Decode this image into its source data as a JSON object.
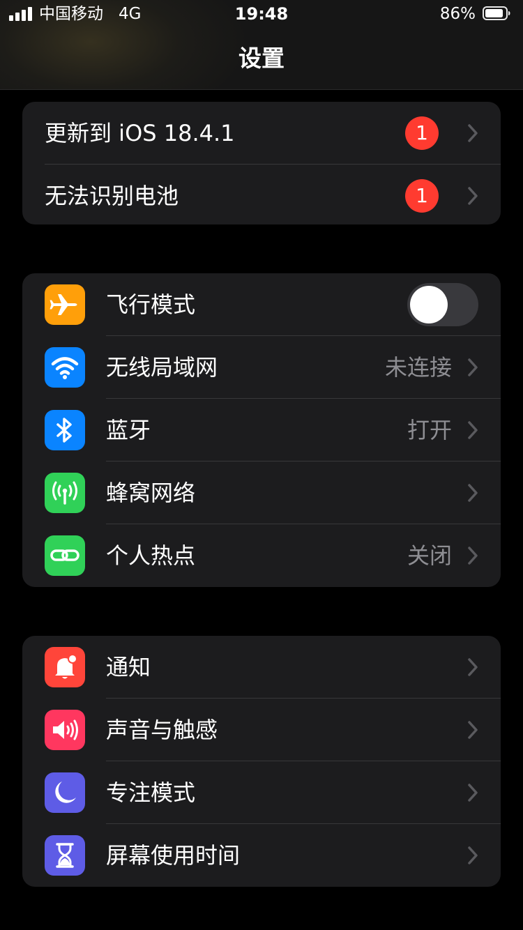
{
  "status_bar": {
    "carrier": "中国移动",
    "network": "4G",
    "time": "19:48",
    "battery_percent": "86%",
    "signal_bars_filled": 4
  },
  "nav": {
    "title": "设置"
  },
  "alerts": [
    {
      "label": "更新到 iOS 18.4.1",
      "badge": "1"
    },
    {
      "label": "无法识别电池",
      "badge": "1"
    }
  ],
  "connectivity": [
    {
      "label": "飞行模式",
      "icon": "airplane-icon",
      "icon_color": "#ff9f0a",
      "toggle_on": false
    },
    {
      "label": "无线局域网",
      "icon": "wifi-icon",
      "icon_color": "#0a84ff",
      "value": "未连接"
    },
    {
      "label": "蓝牙",
      "icon": "bluetooth-icon",
      "icon_color": "#0a84ff",
      "value": "打开"
    },
    {
      "label": "蜂窝网络",
      "icon": "cellular-icon",
      "icon_color": "#30d158"
    },
    {
      "label": "个人热点",
      "icon": "hotspot-icon",
      "icon_color": "#30d158",
      "value": "关闭"
    }
  ],
  "system": [
    {
      "label": "通知",
      "icon": "notification-bell-icon",
      "icon_color": "#ff453a"
    },
    {
      "label": "声音与触感",
      "icon": "speaker-icon",
      "icon_color": "#ff375f"
    },
    {
      "label": "专注模式",
      "icon": "moon-icon",
      "icon_color": "#5e5ce6"
    },
    {
      "label": "屏幕使用时间",
      "icon": "hourglass-icon",
      "icon_color": "#5e5ce6"
    }
  ],
  "colors": {
    "background": "#000000",
    "group_background": "#1c1c1e",
    "separator": "#38383a",
    "secondary_text": "#8e8e93",
    "badge": "#ff3b30",
    "toggle_off": "#39393d"
  }
}
